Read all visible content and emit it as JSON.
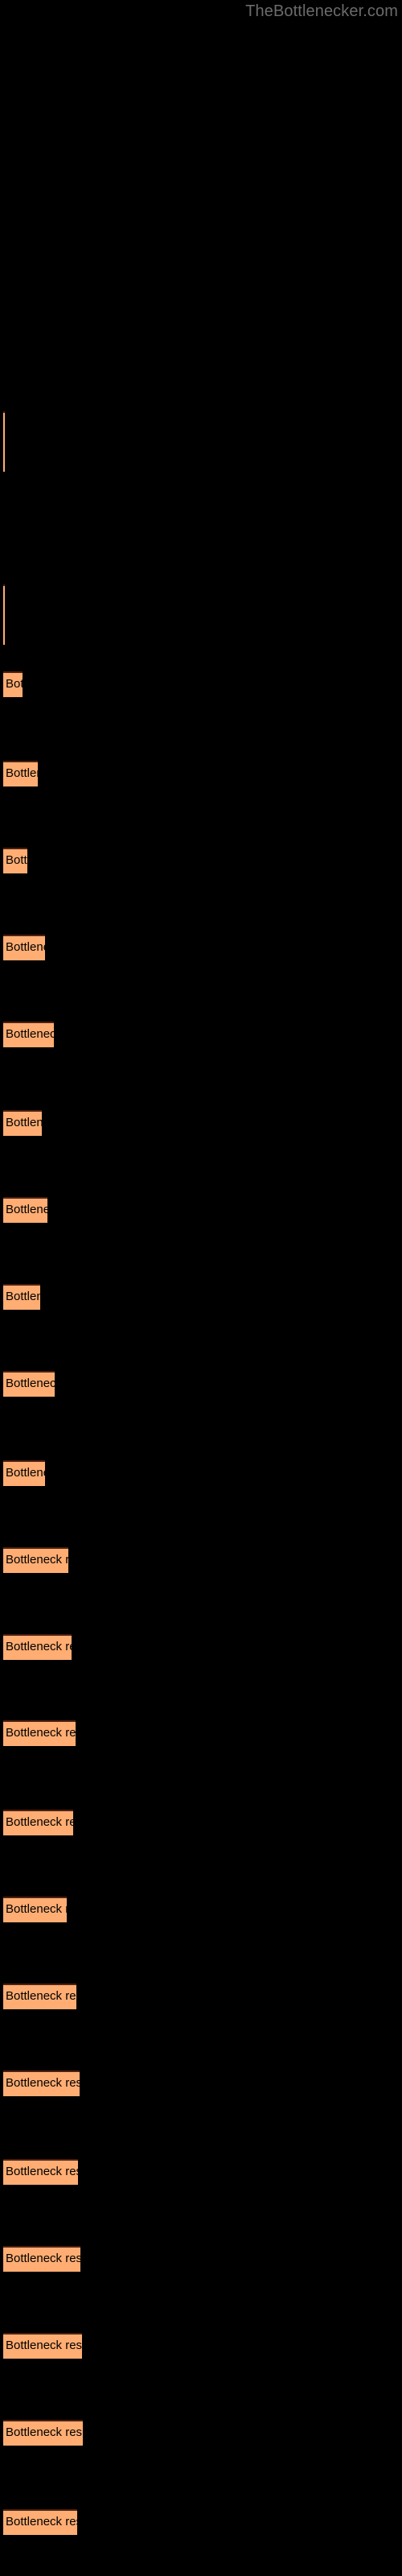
{
  "site": {
    "title": "TheBottlenecker.com",
    "title_color": "#6b6b6b"
  },
  "colors": {
    "background": "#000000",
    "bar_fill": "#ffad73",
    "bar_border": "#4d1f10",
    "bar_label_text": "#000000"
  },
  "bar_label_full": "Bottleneck result",
  "chart_data": {
    "type": "bar",
    "orientation": "horizontal",
    "title": "",
    "subtitle": "",
    "xlabel": "",
    "ylabel": "",
    "grid": false,
    "legend": null,
    "axis_visible": false,
    "tick_labels": [],
    "xlim": [
      0,
      500
    ],
    "bar_label_template": "Bottleneck result",
    "bars": [
      {
        "y": 500,
        "width": 2,
        "label": "",
        "visible_label": ""
      },
      {
        "y": 586,
        "width": 2,
        "label": "Bottleneck result",
        "visible_label": ""
      },
      {
        "y": 629,
        "width": 24,
        "label": "Bottleneck result",
        "visible_label": "Bottl"
      },
      {
        "y": 673,
        "width": 43,
        "label": "Bottleneck result",
        "visible_label": "Bottlenec"
      },
      {
        "y": 716,
        "width": 30,
        "label": "Bottleneck result",
        "visible_label": "Bottler"
      },
      {
        "y": 759,
        "width": 52,
        "label": "Bottleneck result",
        "visible_label": "Bottleneck r"
      },
      {
        "y": 802,
        "width": 63,
        "label": "Bottleneck result",
        "visible_label": "Bottleneck res"
      },
      {
        "y": 846,
        "width": 48,
        "label": "Bottleneck result",
        "visible_label": "Bottleneck"
      },
      {
        "y": 889,
        "width": 55,
        "label": "Bottleneck result",
        "visible_label": "Bottleneck re"
      },
      {
        "y": 932,
        "width": 46,
        "label": "Bottleneck result",
        "visible_label": "Bottlenec"
      },
      {
        "y": 975,
        "width": 64,
        "label": "Bottleneck result",
        "visible_label": "Bottleneck resu"
      },
      {
        "y": 1019,
        "width": 52,
        "label": "Bottleneck result",
        "visible_label": "Bottleneck r"
      },
      {
        "y": 1062,
        "width": 81,
        "label": "Bottleneck result",
        "visible_label": "Bottleneck result"
      },
      {
        "y": 1105,
        "width": 85,
        "label": "Bottleneck result",
        "visible_label": "Bottleneck result"
      },
      {
        "y": 1148,
        "width": 90,
        "label": "Bottleneck result",
        "visible_label": "Bottleneck result"
      },
      {
        "y": 1192,
        "width": 87,
        "label": "Bottleneck result",
        "visible_label": "Bottleneck result"
      },
      {
        "y": 1235,
        "width": 79,
        "label": "Bottleneck result",
        "visible_label": "Bottleneck result"
      },
      {
        "y": 1278,
        "width": 91,
        "label": "Bottleneck result",
        "visible_label": "Bottleneck result"
      },
      {
        "y": 1321,
        "width": 95,
        "label": "Bottleneck result",
        "visible_label": "Bottleneck result"
      },
      {
        "y": 1365,
        "width": 93,
        "label": "Bottleneck result",
        "visible_label": "Bottleneck result"
      },
      {
        "y": 1408,
        "width": 96,
        "label": "Bottleneck result",
        "visible_label": "Bottleneck result"
      },
      {
        "y": 1451,
        "width": 98,
        "label": "Bottleneck result",
        "visible_label": "Bottleneck result"
      },
      {
        "y": 1494,
        "width": 99,
        "label": "Bottleneck result",
        "visible_label": "Bottleneck result"
      },
      {
        "y": 1538,
        "width": 92,
        "label": "Bottleneck result",
        "visible_label": "Bottleneck result"
      }
    ]
  },
  "bars_rendered": [
    {
      "y": 500,
      "width": 2,
      "text": ""
    },
    {
      "y": 586,
      "width": 2,
      "text": ""
    },
    {
      "y": 629,
      "width": 24,
      "text": "Bottleneck result"
    },
    {
      "y": 673,
      "width": 43,
      "text": "Bottleneck result"
    },
    {
      "y": 716,
      "width": 30,
      "text": "Bottleneck result"
    },
    {
      "y": 759,
      "width": 52,
      "text": "Bottleneck result"
    },
    {
      "y": 802,
      "width": 63,
      "text": "Bottleneck result"
    },
    {
      "y": 846,
      "width": 48,
      "text": "Bottleneck result"
    },
    {
      "y": 889,
      "width": 55,
      "text": "Bottleneck result"
    },
    {
      "y": 932,
      "width": 46,
      "text": "Bottleneck result"
    },
    {
      "y": 975,
      "width": 64,
      "text": "Bottleneck result"
    },
    {
      "y": 1019,
      "width": 52,
      "text": "Bottleneck result"
    },
    {
      "y": 1062,
      "width": 81,
      "text": "Bottleneck result"
    },
    {
      "y": 1105,
      "width": 85,
      "text": "Bottleneck result"
    },
    {
      "y": 1148,
      "width": 90,
      "text": "Bottleneck result"
    },
    {
      "y": 1192,
      "width": 87,
      "text": "Bottleneck result"
    },
    {
      "y": 1235,
      "width": 79,
      "text": "Bottleneck result"
    },
    {
      "y": 1278,
      "width": 91,
      "text": "Bottleneck result"
    },
    {
      "y": 1321,
      "width": 95,
      "text": "Bottleneck result"
    },
    {
      "y": 1365,
      "width": 93,
      "text": "Bottleneck result"
    },
    {
      "y": 1408,
      "width": 96,
      "text": "Bottleneck result"
    },
    {
      "y": 1451,
      "width": 98,
      "text": "Bottleneck result"
    },
    {
      "y": 1494,
      "width": 99,
      "text": "Bottleneck result"
    },
    {
      "y": 1538,
      "width": 92,
      "text": "Bottleneck result"
    }
  ]
}
